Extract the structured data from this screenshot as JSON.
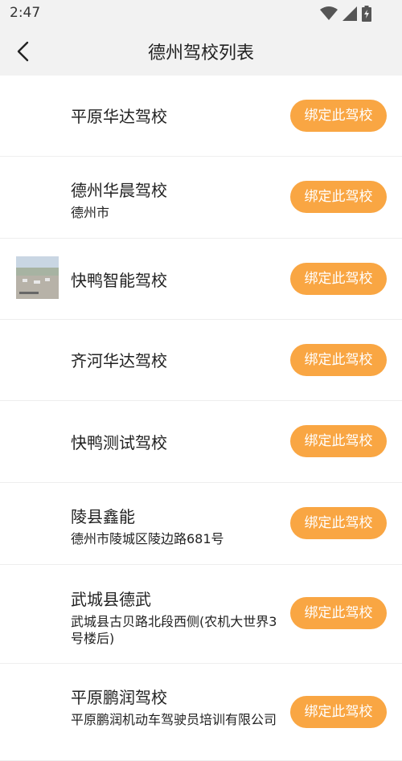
{
  "status_bar": {
    "time": "2:47",
    "icons": [
      "wifi-icon",
      "signal-icon",
      "battery-charging-icon"
    ]
  },
  "header": {
    "title": "德州驾校列表",
    "back_icon": "chevron-left-icon"
  },
  "colors": {
    "accent": "#f9a643",
    "header_bg": "#f2f2f2",
    "divider": "#eeeeee"
  },
  "schools": [
    {
      "name": "平原华达驾校",
      "address": "",
      "button": "绑定此驾校",
      "has_thumb": false
    },
    {
      "name": "德州华晨驾校",
      "address": "德州市",
      "button": "绑定此驾校",
      "has_thumb": false
    },
    {
      "name": "快鸭智能驾校",
      "address": "",
      "button": "绑定此驾校",
      "has_thumb": true
    },
    {
      "name": "齐河华达驾校",
      "address": "",
      "button": "绑定此驾校",
      "has_thumb": false
    },
    {
      "name": "快鸭测试驾校",
      "address": "",
      "button": "绑定此驾校",
      "has_thumb": false
    },
    {
      "name": "陵县鑫能",
      "address": "德州市陵城区陵边路681号",
      "button": "绑定此驾校",
      "has_thumb": false
    },
    {
      "name": "武城县德武",
      "address": "武城县古贝路北段西侧(农机大世界3号楼后)",
      "button": "绑定此驾校",
      "has_thumb": false
    },
    {
      "name": "平原鹏润驾校",
      "address": "平原鹏润机动车驾驶员培训有限公司",
      "button": "绑定此驾校",
      "has_thumb": false
    }
  ]
}
